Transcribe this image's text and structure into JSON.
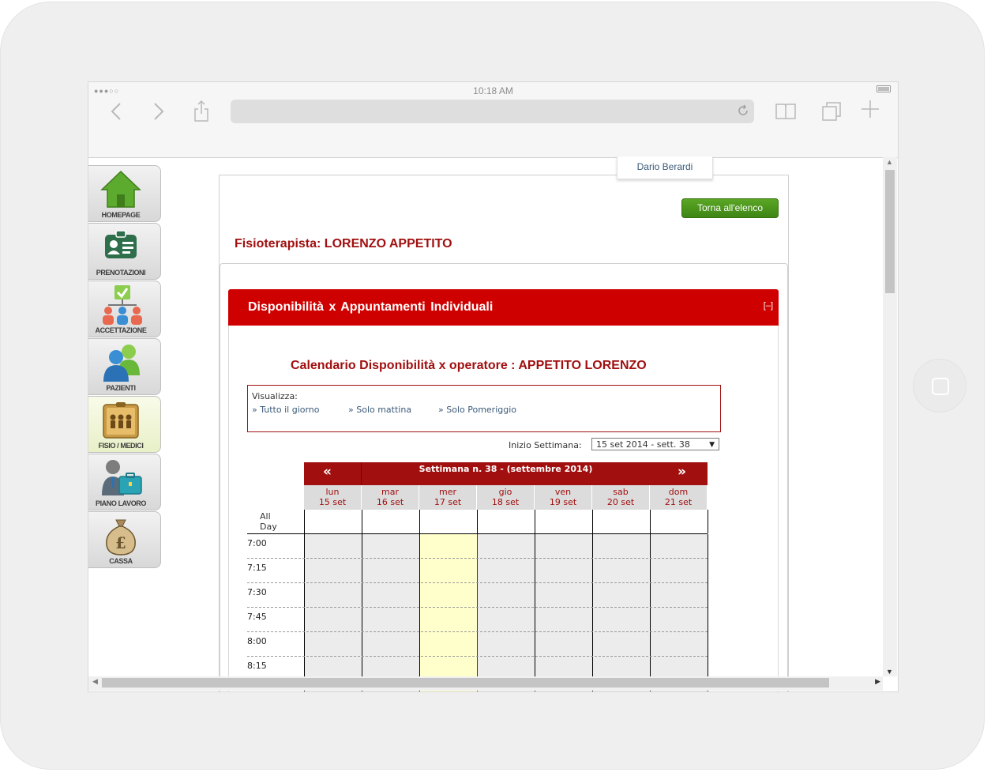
{
  "device": {
    "status_dots": "●●●○○",
    "time": "10:18 AM"
  },
  "user": {
    "name": "Dario Berardi"
  },
  "sidebar": {
    "items": [
      {
        "label": "HOMEPAGE"
      },
      {
        "label": "PRENOTAZIONI"
      },
      {
        "label": "ACCETTAZIONE"
      },
      {
        "label": "PAZIENTI"
      },
      {
        "label": "FISIO / MEDICI"
      },
      {
        "label": "PIANO LAVORO"
      },
      {
        "label": "CASSA"
      }
    ],
    "active_index": 4
  },
  "header": {
    "back_button": "Torna all'elenco",
    "physio_title": "Fisioterapista: LORENZO APPETITO"
  },
  "panel": {
    "title": "Disponibilità x Appuntamenti Individuali",
    "collapse": "[–]"
  },
  "calendar": {
    "title": "Calendario Disponibilità x operatore : APPETITO LORENZO",
    "view_label": "Visualizza:",
    "view_links": [
      "» Tutto il giorno",
      "» Solo mattina",
      "» Solo Pomeriggio"
    ],
    "week_label": "Inizio Settimana:",
    "week_value": "15 set 2014 - sett. 38",
    "prev": "«",
    "next": "»",
    "nav_title": "Settimana n. 38 - (settembre 2014)",
    "days": [
      {
        "name": "lun",
        "date": "15 set"
      },
      {
        "name": "mar",
        "date": "16 set"
      },
      {
        "name": "mer",
        "date": "17 set"
      },
      {
        "name": "gio",
        "date": "18 set"
      },
      {
        "name": "ven",
        "date": "19 set"
      },
      {
        "name": "sab",
        "date": "20 set"
      },
      {
        "name": "dom",
        "date": "21 set"
      }
    ],
    "today_index": 2,
    "all_day": "All Day",
    "times": [
      "7:00",
      "7:15",
      "7:30",
      "7:45",
      "8:00",
      "8:15"
    ]
  }
}
